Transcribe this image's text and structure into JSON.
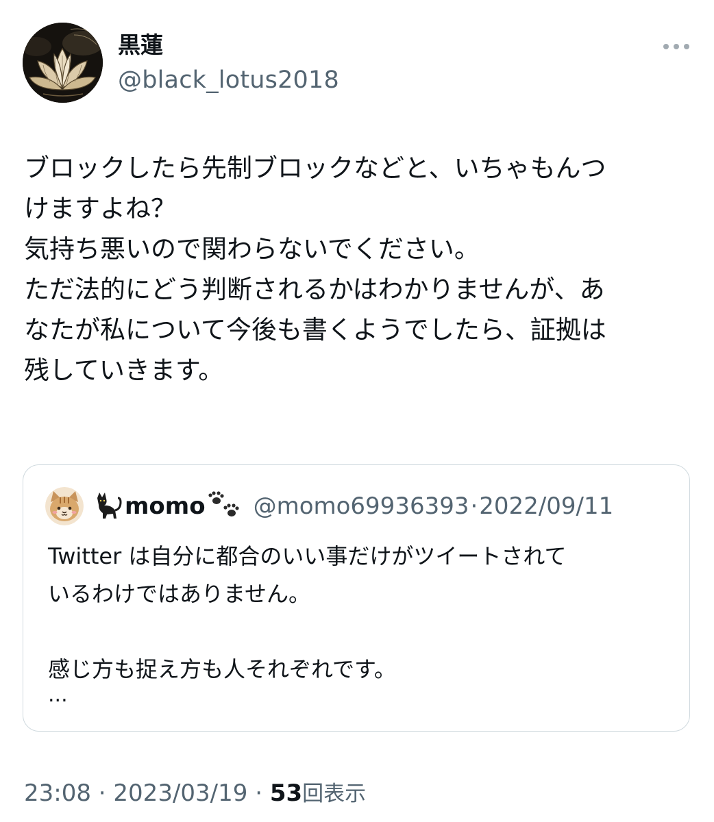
{
  "author": {
    "display_name": "黒蓮",
    "handle": "@black_lotus2018"
  },
  "tweet": {
    "lines": [
      "ブロックしたら先制ブロックなどと、いちゃもんつ",
      "けますよね？",
      "気持ち悪いので関わらないでください。",
      "ただ法的にどう判断されるかはわかりませんが、あ",
      "なたが私について今後も書くようでしたら、証拠は",
      "残していきます。"
    ]
  },
  "quote": {
    "name_prefix_emoji": "🐈‍⬛",
    "name": "momo",
    "name_suffix_emoji": "🐾",
    "handle": "@momo69936393",
    "separator": "·",
    "date": "2022/09/11",
    "lines": [
      "Twitter は自分に都合のいい事だけがツイートされて",
      "いるわけではありません。",
      "",
      "感じ方も捉え方も人それぞれです。"
    ],
    "more": "..."
  },
  "meta": {
    "time": "23:08",
    "sep1": " · ",
    "date": "2023/03/19",
    "sep2": " · ",
    "views_count": "53",
    "views_label": "回表示"
  },
  "icons": {
    "more": "more-horizontal-icon",
    "author_avatar": "lotus-avatar",
    "quote_avatar": "cat-avatar"
  },
  "colors": {
    "text": "#0f1419",
    "secondary": "#536471",
    "border": "#cfd9de"
  }
}
